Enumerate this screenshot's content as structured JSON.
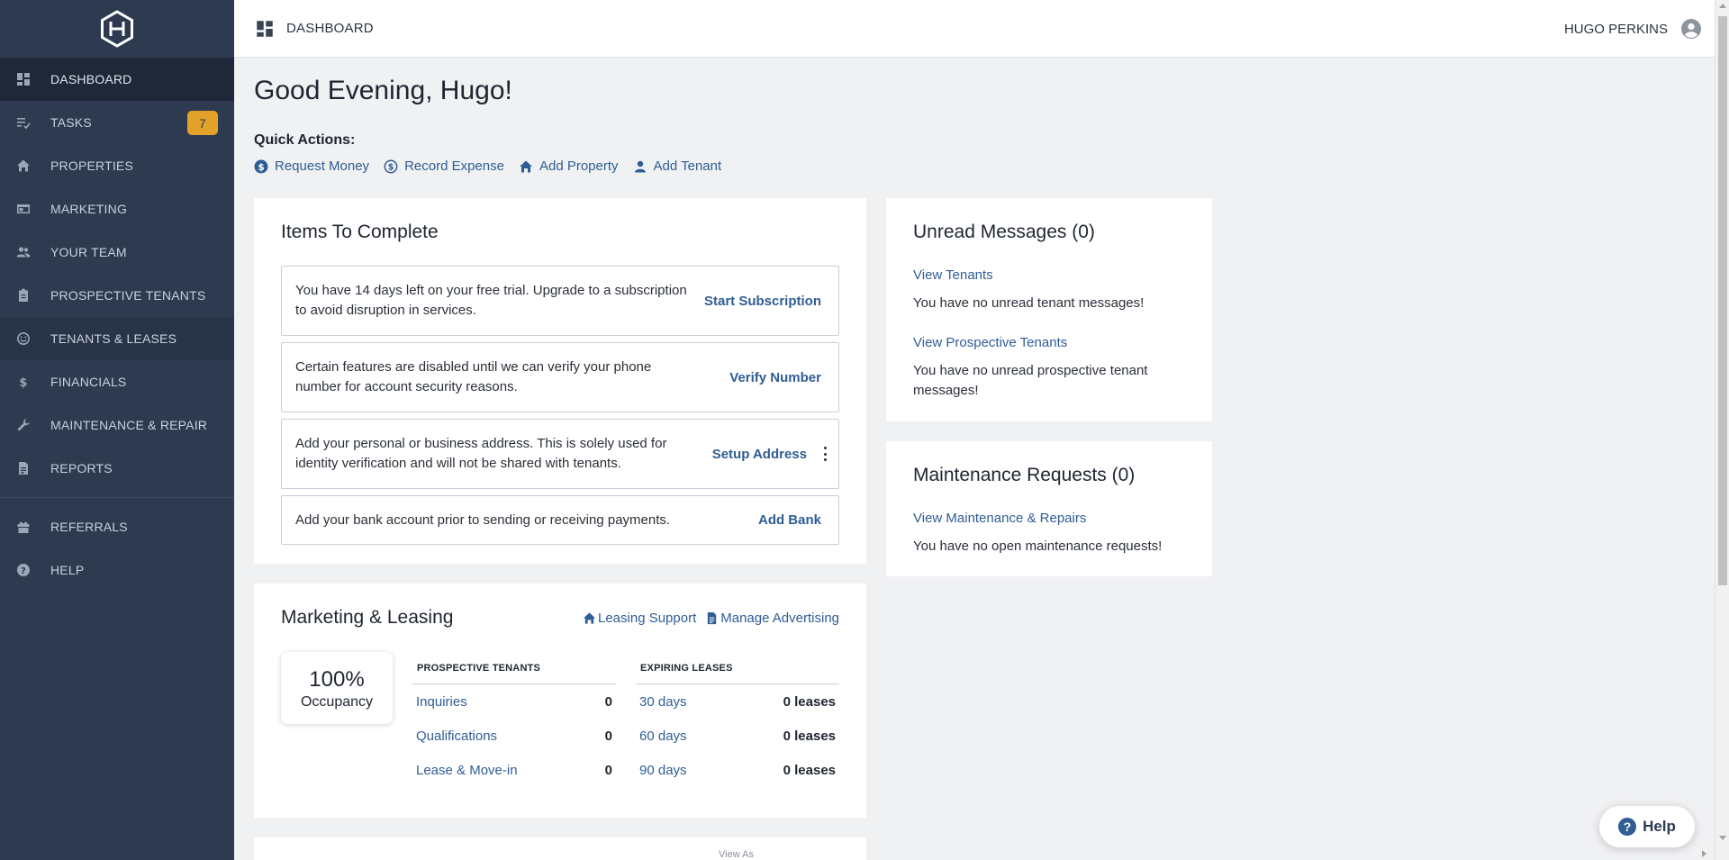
{
  "topbar": {
    "title": "DASHBOARD",
    "user_name": "HUGO PERKINS"
  },
  "sidebar": {
    "items": [
      {
        "label": "DASHBOARD"
      },
      {
        "label": "TASKS",
        "badge": "7"
      },
      {
        "label": "PROPERTIES"
      },
      {
        "label": "MARKETING"
      },
      {
        "label": "YOUR TEAM"
      },
      {
        "label": "PROSPECTIVE TENANTS"
      },
      {
        "label": "TENANTS & LEASES"
      },
      {
        "label": "FINANCIALS"
      },
      {
        "label": "MAINTENANCE & REPAIR"
      },
      {
        "label": "REPORTS"
      },
      {
        "label": "REFERRALS"
      },
      {
        "label": "HELP"
      }
    ]
  },
  "greeting": "Good Evening, Hugo!",
  "quick_actions": {
    "label": "Quick Actions:",
    "items": [
      "Request Money",
      "Record Expense",
      "Add Property",
      "Add Tenant"
    ]
  },
  "items_to_complete": {
    "title": "Items To Complete",
    "tasks": [
      {
        "text": "You have 14 days left on your free trial. Upgrade to a subscription to avoid disruption in services.",
        "action": "Start Subscription"
      },
      {
        "text": "Certain features are disabled until we can verify your phone number for account security reasons.",
        "action": "Verify Number"
      },
      {
        "text": "Add your personal or business address. This is solely used for identity verification and will not be shared with tenants.",
        "action": "Setup Address"
      },
      {
        "text": "Add your bank account prior to sending or receiving payments.",
        "action": "Add Bank"
      }
    ]
  },
  "messages": {
    "title": "Unread Messages (0)",
    "view_tenants": "View Tenants",
    "no_tenant_msgs": "You have no unread tenant messages!",
    "view_prospective": "View Prospective Tenants",
    "no_prospective_msgs": "You have no unread prospective tenant messages!"
  },
  "maintenance": {
    "title": "Maintenance Requests (0)",
    "view_link": "View Maintenance & Repairs",
    "no_requests": "You have no open maintenance requests!"
  },
  "marketing": {
    "title": "Marketing & Leasing",
    "leasing_support": "Leasing Support",
    "manage_advertising": "Manage Advertising",
    "occupancy_value": "100%",
    "occupancy_label": "Occupancy",
    "prospective": {
      "header": "PROSPECTIVE TENANTS",
      "rows": [
        {
          "label": "Inquiries",
          "value": "0"
        },
        {
          "label": "Qualifications",
          "value": "0"
        },
        {
          "label": "Lease & Move-in",
          "value": "0"
        }
      ]
    },
    "expiring": {
      "header": "EXPIRING LEASES",
      "rows": [
        {
          "label": "30 days",
          "value": "0 leases"
        },
        {
          "label": "60 days",
          "value": "0 leases"
        },
        {
          "label": "90 days",
          "value": "0 leases"
        }
      ]
    }
  },
  "next_card": {
    "view_as": "View As"
  },
  "help_button": {
    "label": "Help"
  },
  "colors": {
    "sidebar": "#2d3a4f",
    "link": "#2f5d94",
    "badge": "#e2a22a"
  }
}
